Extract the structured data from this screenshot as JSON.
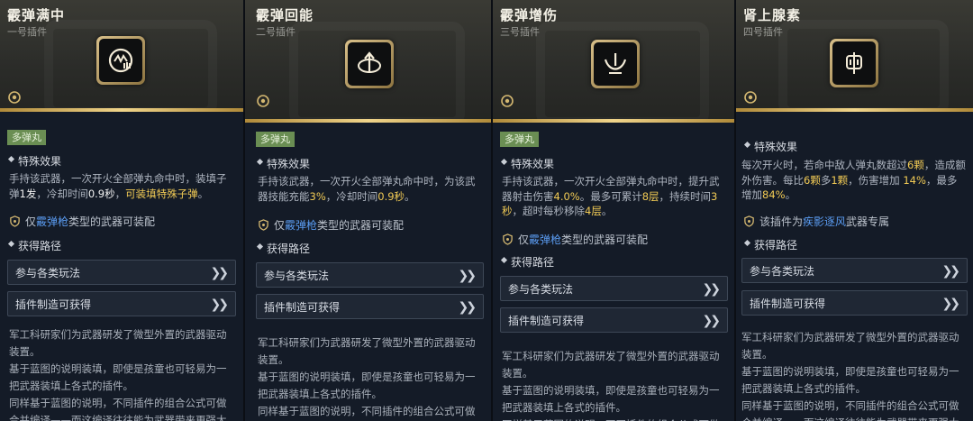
{
  "cards": [
    {
      "title": "霰弹满中",
      "slot": "一号插件",
      "tag": "多弹丸",
      "effect_title": "特殊效果",
      "effect": [
        {
          "t": "手持该武器，一次开火全部弹丸命中时，装填子弹",
          "c": ""
        },
        {
          "t": "1发",
          "c": "w"
        },
        {
          "t": "，冷却时间",
          "c": ""
        },
        {
          "t": "0.9秒",
          "c": "w"
        },
        {
          "t": "，",
          "c": ""
        },
        {
          "t": "可装填特殊子弹",
          "c": "y"
        },
        {
          "t": "。",
          "c": ""
        }
      ],
      "restrict_pre": "仅",
      "restrict_kw": "霰弹枪",
      "restrict_post": "类型的武器可装配",
      "routes_title": "获得路径",
      "routes": [
        "参与各类玩法",
        "插件制造可获得"
      ],
      "lore": "军工科研家们为武器研发了微型外置的武器驱动装置。\n基于蓝图的说明装填，即使是孩童也可轻易为一把武器装填上各式的插件。\n同样基于蓝图的说明，不同插件的组合公式可做合并编译——而这编译往往能为武器带来更强大"
    },
    {
      "title": "霰弹回能",
      "slot": "二号插件",
      "tag": "多弹丸",
      "effect_title": "特殊效果",
      "effect": [
        {
          "t": "手持该武器，一次开火全部弹丸命中时，为该武器技能充能",
          "c": ""
        },
        {
          "t": "3%",
          "c": "y"
        },
        {
          "t": "，冷却时间",
          "c": ""
        },
        {
          "t": "0.9秒",
          "c": "y"
        },
        {
          "t": "。",
          "c": ""
        }
      ],
      "restrict_pre": "仅",
      "restrict_kw": "霰弹枪",
      "restrict_post": "类型的武器可装配",
      "routes_title": "获得路径",
      "routes": [
        "参与各类玩法",
        "插件制造可获得"
      ],
      "lore": "军工科研家们为武器研发了微型外置的武器驱动装置。\n基于蓝图的说明装填，即使是孩童也可轻易为一把武器装填上各式的插件。\n同样基于蓝图的说明，不同插件的组合公式可做合并编译——而这编译往往能为武器带来更强大"
    },
    {
      "title": "霰弹增伤",
      "slot": "三号插件",
      "tag": "多弹丸",
      "effect_title": "特殊效果",
      "effect": [
        {
          "t": "手持该武器，一次开火全部弹丸命中时，提升武器射击伤害",
          "c": ""
        },
        {
          "t": "4.0%",
          "c": "y"
        },
        {
          "t": "。最多可累计",
          "c": ""
        },
        {
          "t": "8层",
          "c": "y"
        },
        {
          "t": "，持续时间",
          "c": ""
        },
        {
          "t": "3秒",
          "c": "y"
        },
        {
          "t": "，超时每秒移除",
          "c": ""
        },
        {
          "t": "4层",
          "c": "y"
        },
        {
          "t": "。",
          "c": ""
        }
      ],
      "restrict_pre": "仅",
      "restrict_kw": "霰弹枪",
      "restrict_post": "类型的武器可装配",
      "routes_title": "获得路径",
      "routes": [
        "参与各类玩法",
        "插件制造可获得"
      ],
      "lore": "军工科研家们为武器研发了微型外置的武器驱动装置。\n基于蓝图的说明装填，即使是孩童也可轻易为一把武器装填上各式的插件。\n同样基于蓝图的说明，不同插件的组合公式可做"
    },
    {
      "title": "肾上腺素",
      "slot": "四号插件",
      "tag": "",
      "effect_title": "特殊效果",
      "effect": [
        {
          "t": "每次开火时，若命中敌人弹丸数超过",
          "c": ""
        },
        {
          "t": "6颗",
          "c": "y"
        },
        {
          "t": "，造成额外伤害。每比",
          "c": ""
        },
        {
          "t": "6颗",
          "c": "y"
        },
        {
          "t": "多",
          "c": ""
        },
        {
          "t": "1颗",
          "c": "y"
        },
        {
          "t": "，伤害增加 ",
          "c": ""
        },
        {
          "t": "14%",
          "c": "y"
        },
        {
          "t": "，最多增加",
          "c": ""
        },
        {
          "t": "84%",
          "c": "y"
        },
        {
          "t": "。",
          "c": ""
        }
      ],
      "restrict_pre": "该插件为",
      "restrict_kw": "疾影逐风",
      "restrict_post": "武器专属",
      "routes_title": "获得路径",
      "routes": [
        "参与各类玩法",
        "插件制造可获得"
      ],
      "lore": "军工科研家们为武器研发了微型外置的武器驱动装置。\n基于蓝图的说明装填，即使是孩童也可轻易为一把武器装填上各式的插件。\n同样基于蓝图的说明，不同插件的组合公式可做合并编译——而这编译往往能为武器带来更强大"
    }
  ],
  "icons": {
    "emblem_1": "shotgun-full-hit-icon",
    "emblem_2": "shotgun-recharge-icon",
    "emblem_3": "shotgun-damage-icon",
    "emblem_4": "adrenaline-icon",
    "gear": "plugin-gear-icon",
    "restrict": "shield-icon",
    "route_arrow": "double-chevron-right-icon"
  },
  "colors": {
    "accent_gold": "#d9c08a",
    "tag_green": "#6a8e53",
    "highlight_yellow": "#f2cb55",
    "keyword_blue": "#5a9bf0"
  }
}
